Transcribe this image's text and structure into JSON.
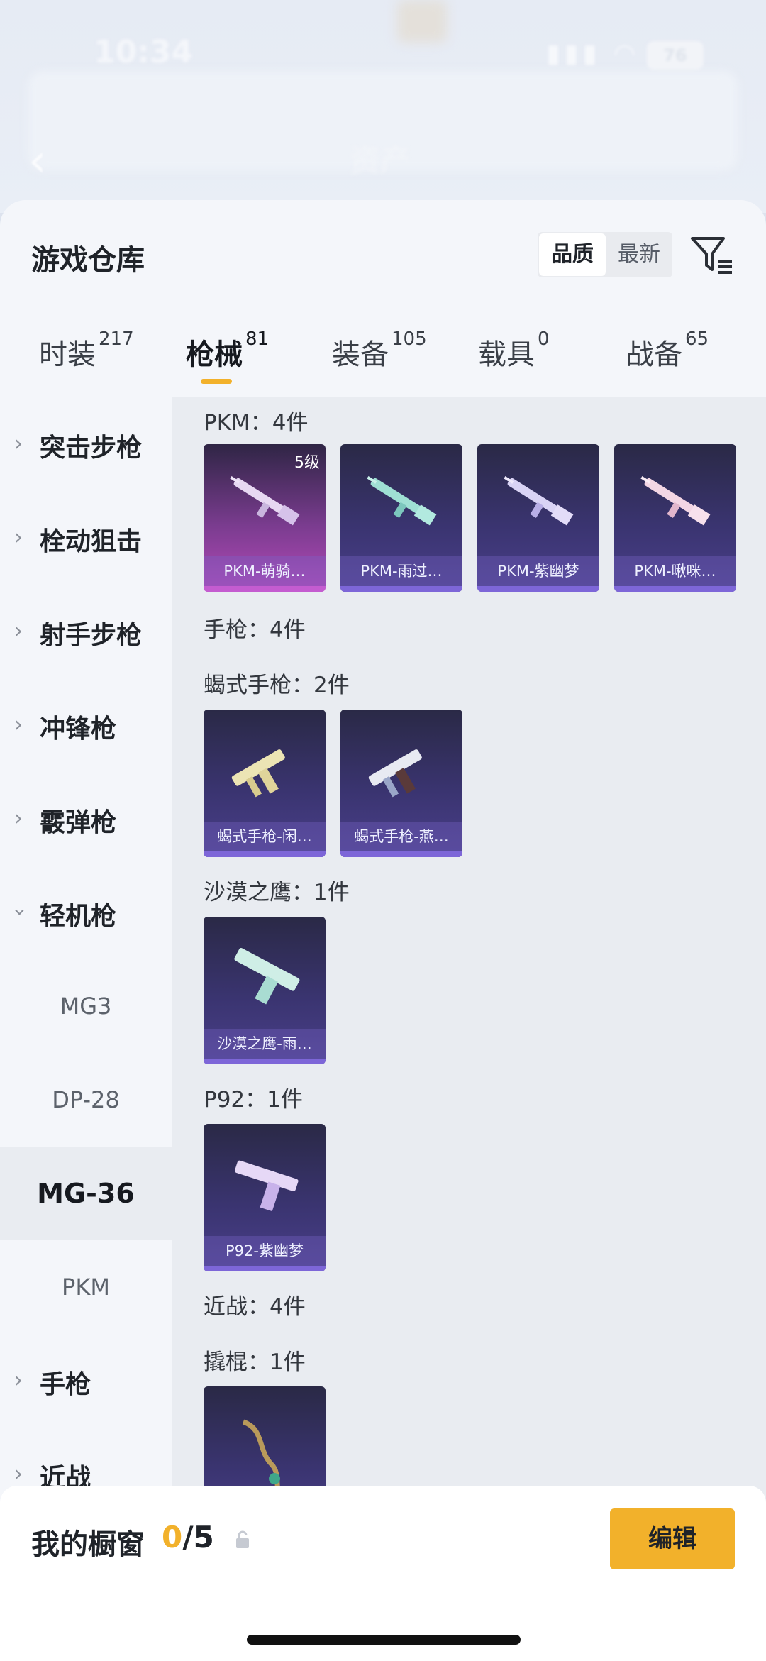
{
  "status_bar": {
    "time": "10:34",
    "battery": "76"
  },
  "header": {
    "title": "资产"
  },
  "warehouse": {
    "title": "游戏仓库",
    "sort": [
      "品质",
      "最新"
    ],
    "tabs": [
      {
        "label": "时装",
        "count": "217"
      },
      {
        "label": "枪械",
        "count": "81"
      },
      {
        "label": "装备",
        "count": "105"
      },
      {
        "label": "载具",
        "count": "0"
      },
      {
        "label": "战备",
        "count": "65"
      }
    ]
  },
  "sidebar": {
    "categories": [
      "突击步枪",
      "栓动狙击",
      "射手步枪",
      "冲锋枪",
      "霰弹枪",
      "轻机枪",
      "手枪",
      "近战"
    ],
    "subitems": [
      "MG3",
      "DP-28",
      "MG-36",
      "PKM"
    ]
  },
  "groups": [
    {
      "header": "PKM：4件",
      "cards": [
        {
          "name": "PKM-萌骑…",
          "level": "5级"
        },
        {
          "name": "PKM-雨过…"
        },
        {
          "name": "PKM-紫幽梦"
        },
        {
          "name": "PKM-啾咪…"
        }
      ]
    },
    {
      "header": "手枪：4件"
    },
    {
      "header": "蝎式手枪：2件",
      "cards": [
        {
          "name": "蝎式手枪-闲…"
        },
        {
          "name": "蝎式手枪-燕…"
        }
      ]
    },
    {
      "header": "沙漠之鹰：1件",
      "cards": [
        {
          "name": "沙漠之鹰-雨…"
        }
      ]
    },
    {
      "header": "P92：1件",
      "cards": [
        {
          "name": "P92-紫幽梦"
        }
      ]
    },
    {
      "header": "近战：4件"
    },
    {
      "header": "撬棍：1件"
    }
  ],
  "showcase": {
    "label": "我的橱窗",
    "used": "0",
    "sep_total": "/5",
    "edit": "编辑"
  },
  "colors": {
    "accent": "#f2b12b",
    "card_purple": "#3a3470",
    "card_pink": "#b449b8"
  }
}
